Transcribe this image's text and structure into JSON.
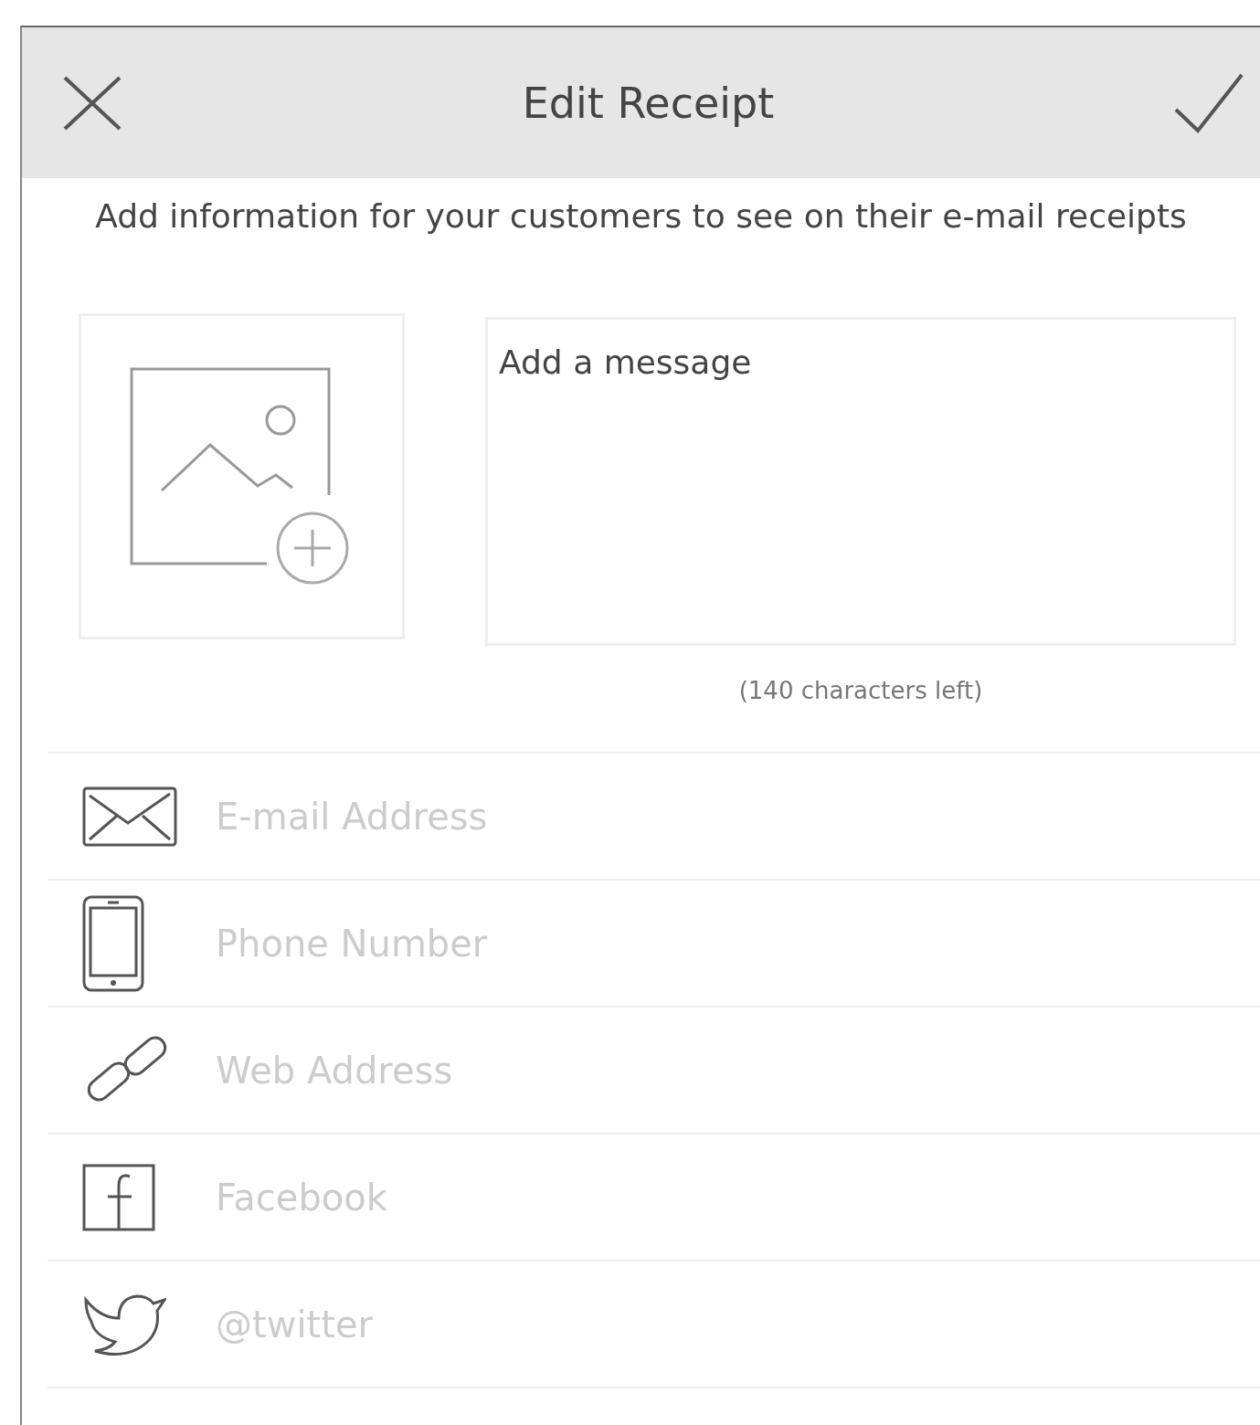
{
  "header": {
    "title": "Edit Receipt"
  },
  "intro": "Add information for your customers to see on their e-mail receipts",
  "message": {
    "placeholder": "Add a message",
    "counter": "(140 characters left)"
  },
  "fields": [
    {
      "kind": "email",
      "placeholder": "E-mail Address"
    },
    {
      "kind": "phone",
      "placeholder": "Phone Number"
    },
    {
      "kind": "web",
      "placeholder": "Web Address"
    },
    {
      "kind": "facebook",
      "placeholder": "Facebook"
    },
    {
      "kind": "twitter",
      "placeholder": "@twitter"
    }
  ]
}
